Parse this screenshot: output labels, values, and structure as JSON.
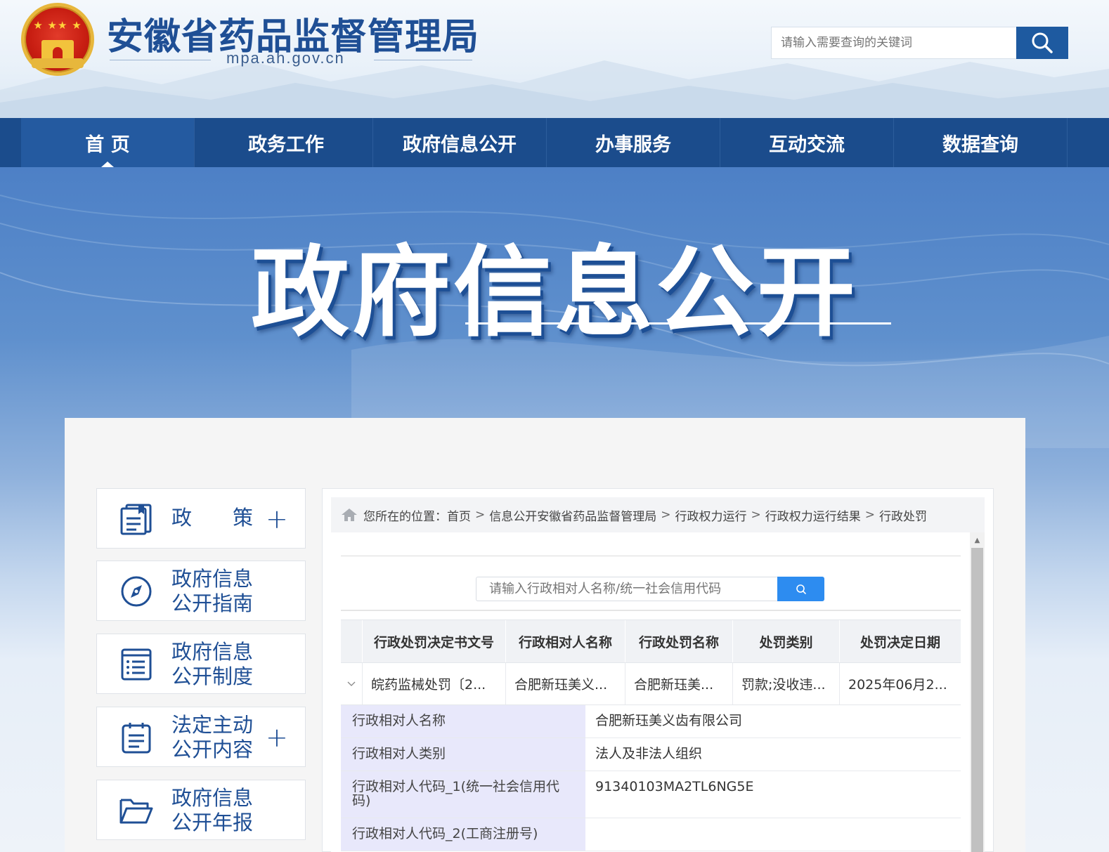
{
  "header": {
    "site_title": "安徽省药品监督管理局",
    "site_url": "mpa.ah.gov.cn",
    "search_placeholder": "请输入需要查询的关键词"
  },
  "nav": {
    "items": [
      {
        "label": "首 页",
        "active": true
      },
      {
        "label": "政务工作"
      },
      {
        "label": "政府信息公开"
      },
      {
        "label": "办事服务"
      },
      {
        "label": "互动交流"
      },
      {
        "label": "数据查询"
      }
    ]
  },
  "banner": {
    "title": "政府信息公开"
  },
  "sidebar": {
    "items": [
      {
        "line1": "政　　策",
        "line2": "",
        "icon": "policy-book-icon",
        "expandable": true
      },
      {
        "line1": "政府信息",
        "line2": "公开指南",
        "icon": "compass-icon",
        "expandable": false
      },
      {
        "line1": "政府信息",
        "line2": "公开制度",
        "icon": "list-document-icon",
        "expandable": false
      },
      {
        "line1": "法定主动",
        "line2": "公开内容",
        "icon": "clipboard-icon",
        "expandable": true
      },
      {
        "line1": "政府信息",
        "line2": "公开年报",
        "icon": "folder-icon",
        "expandable": false
      }
    ]
  },
  "breadcrumb": {
    "prefix": "您所在的位置：",
    "items": [
      "首页",
      "信息公开安徽省药品监督管理局",
      "行政权力运行",
      "行政权力运行结果",
      "行政处罚"
    ],
    "separator": ">"
  },
  "query": {
    "placeholder": "请输入行政相对人名称/统一社会信用代码"
  },
  "table": {
    "headers": [
      "行政处罚决定书文号",
      "行政相对人名称",
      "行政处罚名称",
      "处罚类别",
      "处罚决定日期"
    ],
    "rows": [
      [
        "皖药监械处罚〔2...",
        "合肥新珏美义...",
        "合肥新珏美...",
        "罚款;没收违...",
        "2025年06月2..."
      ]
    ]
  },
  "detail": {
    "rows": [
      {
        "key": "行政相对人名称",
        "value": "合肥新珏美义齿有限公司"
      },
      {
        "key": "行政相对人类别",
        "value": "法人及非法人组织"
      },
      {
        "key": "行政相对人代码_1(统一社会信用代码)",
        "value": "91340103MA2TL6NG5E"
      },
      {
        "key": "行政相对人代码_2(工商注册号)",
        "value": ""
      }
    ]
  },
  "colors": {
    "brand_blue": "#1f4f95",
    "nav_bg": "#1b4c8c",
    "search_btn": "#1e5aa0",
    "query_btn": "#2d8cf0",
    "detail_key_bg": "#e8e8fb"
  }
}
